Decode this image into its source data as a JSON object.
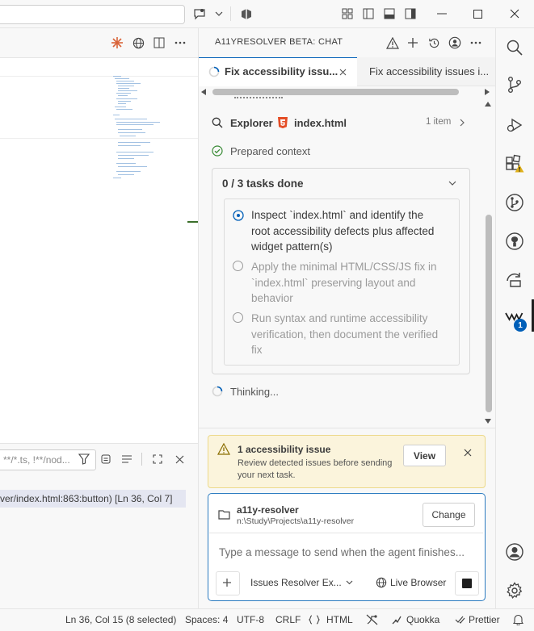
{
  "titlebar": {},
  "panel": {
    "filter_placeholder": "**/*.ts, !**/nod...",
    "output_text": "ver/index.html:863:button)  [Ln 36, Col 7]"
  },
  "chat": {
    "title": "A11YRESOLVER BETA: CHAT",
    "tabs": [
      {
        "label": "Fix accessibility issu..."
      },
      {
        "label": "Fix accessibility issues i..."
      }
    ],
    "explorer": {
      "label": "Explorer",
      "file": "index.html",
      "count": "1 item"
    },
    "prepared": "Prepared context",
    "tasks": {
      "header": "0 / 3 tasks done",
      "items": [
        {
          "text": "Inspect `index.html` and identify the root accessibility defects plus affected widget pattern(s)"
        },
        {
          "text": "Apply the minimal HTML/CSS/JS fix in `index.html` preserving layout and behavior"
        },
        {
          "text": "Run syntax and runtime accessibility verification, then document the verified fix"
        }
      ]
    },
    "thinking": "Thinking...",
    "issue": {
      "title": "1 accessibility issue",
      "desc": "Review detected issues before sending your next task.",
      "view": "View"
    },
    "project": {
      "name": "a11y-resolver",
      "path": "n:\\Study\\Projects\\a11y-resolver",
      "change": "Change"
    },
    "input_placeholder": "Type a message to send when the agent finishes...",
    "mode": "Issues Resolver Ex...",
    "browser": "Live Browser"
  },
  "activity": {
    "badge": "1"
  },
  "statusbar": {
    "position": "Ln 36, Col 15 (8 selected)",
    "spaces": "Spaces: 4",
    "encoding": "UTF-8",
    "eol": "CRLF",
    "language": "HTML",
    "quokka": "Quokka",
    "prettier": "Prettier"
  },
  "colors": {
    "accent": "#005fb8",
    "warning_bg": "#fbf4dc",
    "badge": "#005fb8"
  }
}
